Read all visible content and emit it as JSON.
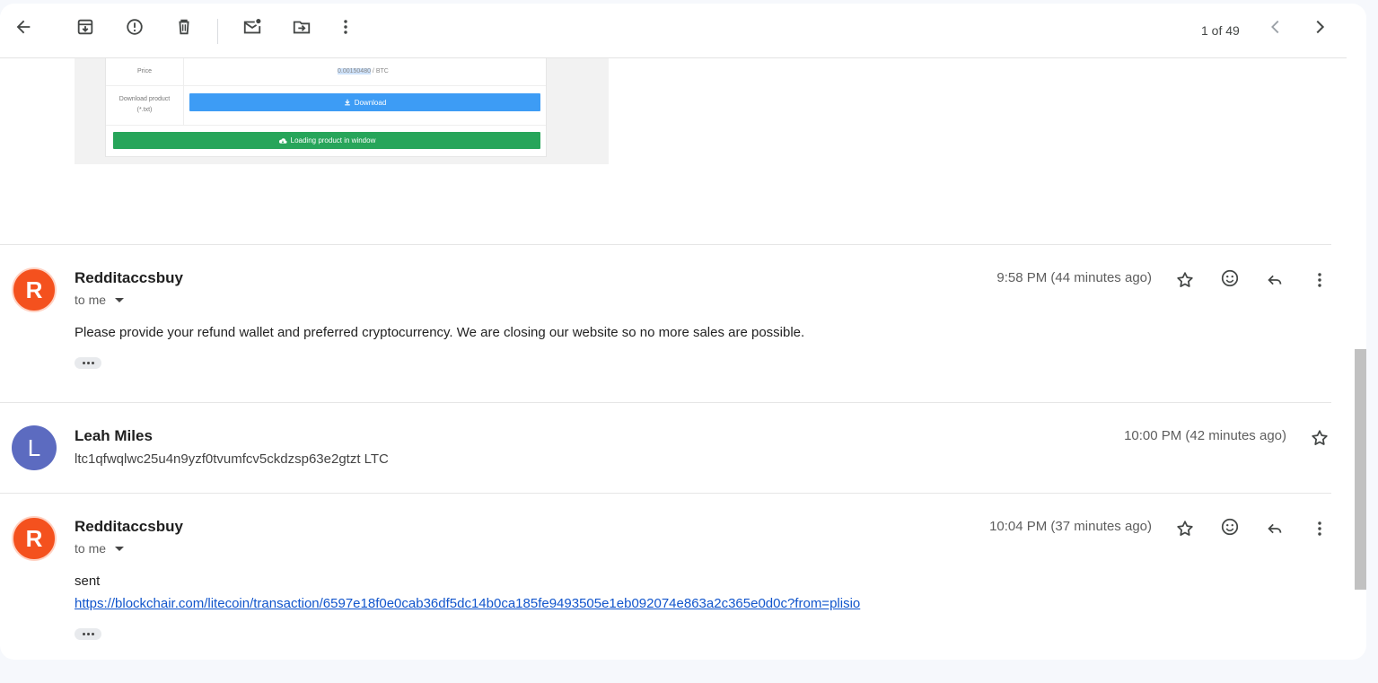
{
  "toolbar": {
    "icons": [
      "back-arrow-icon",
      "archive-icon",
      "report-spam-icon",
      "delete-icon",
      "mark-unread-icon",
      "move-to-icon",
      "more-vert-icon"
    ],
    "count": "1 of 49"
  },
  "embed": {
    "price_label": "Price",
    "price_value_hl": "0.00150480",
    "price_value_rest": " / BTC",
    "download_label_1": "Download product",
    "download_label_2": "(*.txt)",
    "download_button": "Download",
    "loading_button": "Loading product in window"
  },
  "messages": [
    {
      "avatar_letter": "R",
      "avatar_color": "#f4511e",
      "sender": "Redditaccsbuy",
      "to": "to me",
      "time": "9:58 PM (44 minutes ago)",
      "body": "Please provide your refund wallet and preferred cryptocurrency. We are closing our website so no more sales are possible."
    },
    {
      "avatar_letter": "L",
      "avatar_color": "#5c6bc0",
      "sender": "Leah Miles",
      "time": "10:00 PM (42 minutes ago)",
      "snippet": "ltc1qfwqlwc25u4n9yzf0tvumfcv5ckdzsp63e2gtzt LTC"
    },
    {
      "avatar_letter": "R",
      "avatar_color": "#f4511e",
      "sender": "Redditaccsbuy",
      "to": "to me",
      "time": "10:04 PM (37 minutes ago)",
      "body": "sent",
      "link": "https://blockchair.com/litecoin/transaction/6597e18f0e0cab36df5dc14b0ca185fe9493505e1eb092074e863a2c365e0d0c?from=plisio"
    }
  ]
}
